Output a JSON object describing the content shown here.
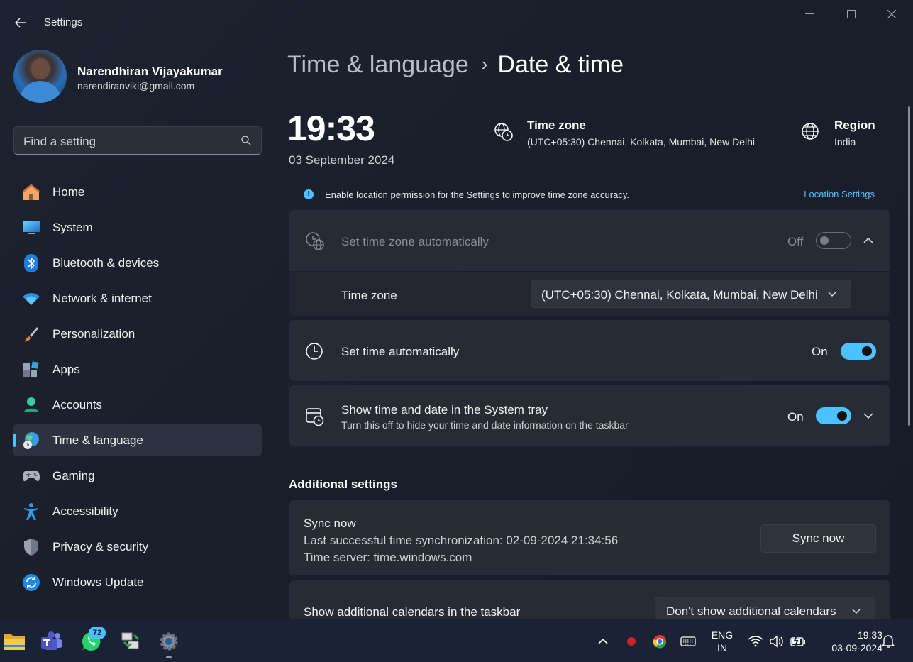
{
  "window": {
    "title": "Settings"
  },
  "profile": {
    "name": "Narendhiran Vijayakumar",
    "email": "narendiranviki@gmail.com"
  },
  "search": {
    "placeholder": "Find a setting"
  },
  "nav": [
    {
      "label": "Home",
      "icon": "home-icon"
    },
    {
      "label": "System",
      "icon": "monitor-icon"
    },
    {
      "label": "Bluetooth & devices",
      "icon": "bluetooth-icon"
    },
    {
      "label": "Network & internet",
      "icon": "wifi-icon"
    },
    {
      "label": "Personalization",
      "icon": "brush-icon"
    },
    {
      "label": "Apps",
      "icon": "apps-icon"
    },
    {
      "label": "Accounts",
      "icon": "person-icon"
    },
    {
      "label": "Time & language",
      "icon": "globe-clock-icon",
      "active": true
    },
    {
      "label": "Gaming",
      "icon": "gamepad-icon"
    },
    {
      "label": "Accessibility",
      "icon": "accessibility-icon"
    },
    {
      "label": "Privacy & security",
      "icon": "shield-icon"
    },
    {
      "label": "Windows Update",
      "icon": "update-icon"
    }
  ],
  "breadcrumb": {
    "parent": "Time & language",
    "separator": "›",
    "current": "Date & time"
  },
  "clock": {
    "time": "19:33",
    "date": "03 September 2024"
  },
  "time_zone_summary": {
    "title": "Time zone",
    "value": "(UTC+05:30) Chennai, Kolkata, Mumbai, New Delhi"
  },
  "region_summary": {
    "title": "Region",
    "value": "India"
  },
  "info_bar": {
    "text": "Enable location permission for the Settings to improve time zone accuracy.",
    "link": "Location Settings"
  },
  "settings": {
    "auto_timezone": {
      "label": "Set time zone automatically",
      "state": "Off"
    },
    "time_zone": {
      "label": "Time zone",
      "value": "(UTC+05:30) Chennai, Kolkata, Mumbai, New Delhi"
    },
    "auto_time": {
      "label": "Set time automatically",
      "state": "On"
    },
    "system_tray": {
      "label": "Show time and date in the System tray",
      "description": "Turn this off to hide your time and date information on the taskbar",
      "state": "On"
    }
  },
  "additional": {
    "title": "Additional settings",
    "sync": {
      "title": "Sync now",
      "last_sync": "Last successful time synchronization: 02-09-2024 21:34:56",
      "server": "Time server: time.windows.com",
      "button": "Sync now"
    },
    "calendars": {
      "label": "Show additional calendars in the taskbar",
      "value": "Don't show additional calendars"
    }
  },
  "taskbar": {
    "whatsapp_badge": "72",
    "language_line1": "ENG",
    "language_line2": "IN",
    "time": "19:33",
    "date": "03-09-2024"
  },
  "colors": {
    "accent": "#4cc2ff",
    "window_bg": "#1b1f2b",
    "card_bg": "#272b36"
  }
}
